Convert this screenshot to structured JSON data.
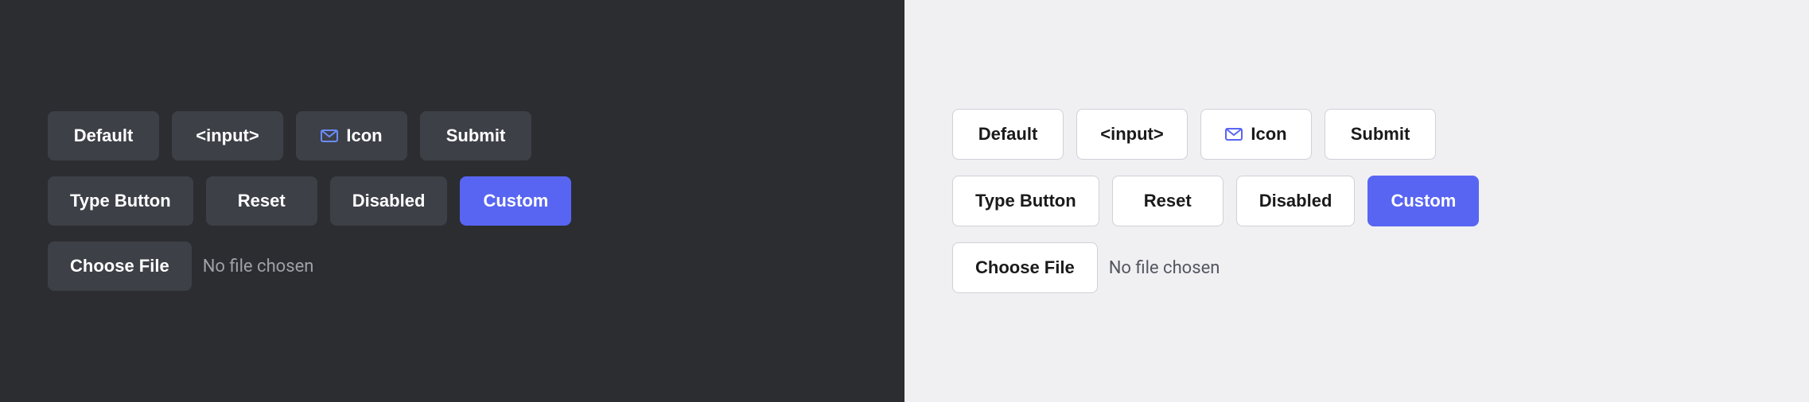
{
  "dark_panel": {
    "row1": {
      "buttons": [
        {
          "label": "Default",
          "name": "default-button-dark"
        },
        {
          "label": "<input>",
          "name": "input-button-dark"
        },
        {
          "label": "Icon",
          "name": "icon-button-dark",
          "has_icon": true
        },
        {
          "label": "Submit",
          "name": "submit-button-dark"
        }
      ]
    },
    "row2": {
      "buttons": [
        {
          "label": "Type Button",
          "name": "type-button-dark"
        },
        {
          "label": "Reset",
          "name": "reset-button-dark"
        },
        {
          "label": "Disabled",
          "name": "disabled-button-dark"
        },
        {
          "label": "Custom",
          "name": "custom-button-dark",
          "custom": true
        }
      ]
    },
    "file_row": {
      "choose_label": "Choose File",
      "no_file_label": "No file chosen"
    }
  },
  "light_panel": {
    "row1": {
      "buttons": [
        {
          "label": "Default",
          "name": "default-button-light"
        },
        {
          "label": "<input>",
          "name": "input-button-light"
        },
        {
          "label": "Icon",
          "name": "icon-button-light",
          "has_icon": true
        },
        {
          "label": "Submit",
          "name": "submit-button-light"
        }
      ]
    },
    "row2": {
      "buttons": [
        {
          "label": "Type Button",
          "name": "type-button-light"
        },
        {
          "label": "Reset",
          "name": "reset-button-light"
        },
        {
          "label": "Disabled",
          "name": "disabled-button-light"
        },
        {
          "label": "Custom",
          "name": "custom-button-light",
          "custom": true
        }
      ]
    },
    "file_row": {
      "choose_label": "Choose File",
      "no_file_label": "No file chosen"
    }
  }
}
